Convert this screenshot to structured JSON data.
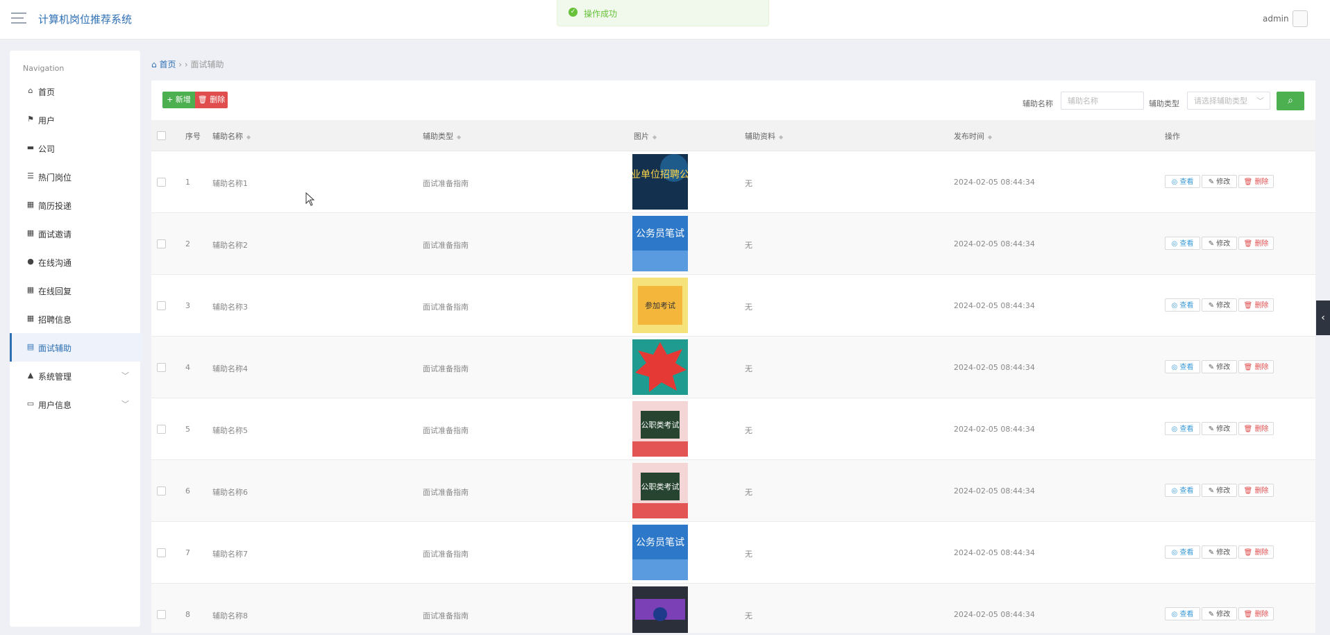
{
  "header": {
    "app_title": "计算机岗位推荐系统",
    "user": "admin",
    "toast": "操作成功"
  },
  "sidebar": {
    "nav_title": "Navigation",
    "items": [
      {
        "label": "首页",
        "icon": "home-icon"
      },
      {
        "label": "用户",
        "icon": "flag-icon"
      },
      {
        "label": "公司",
        "icon": "briefcase-icon"
      },
      {
        "label": "热门岗位",
        "icon": "list-icon"
      },
      {
        "label": "简历投递",
        "icon": "grid-icon"
      },
      {
        "label": "面试邀请",
        "icon": "grid-icon"
      },
      {
        "label": "在线沟通",
        "icon": "map-pin-icon"
      },
      {
        "label": "在线回复",
        "icon": "grid-icon"
      },
      {
        "label": "招聘信息",
        "icon": "grid-icon"
      },
      {
        "label": "面试辅助",
        "icon": "chat-icon",
        "active": true
      },
      {
        "label": "系统管理",
        "icon": "chart-icon",
        "expandable": true
      },
      {
        "label": "用户信息",
        "icon": "card-icon",
        "expandable": true
      }
    ]
  },
  "breadcrumb": {
    "home": "首页",
    "separator": "› ›",
    "current": "面试辅助"
  },
  "toolbar": {
    "add_label": "新增",
    "delete_label": "删除",
    "name_label": "辅助名称",
    "name_placeholder": "辅助名称",
    "type_label": "辅助类型",
    "type_placeholder": "请选择辅助类型"
  },
  "table": {
    "columns": [
      "序号",
      "辅助名称",
      "辅助类型",
      "图片",
      "辅助资料",
      "发布时间",
      "操作"
    ],
    "actions": {
      "view": "查看",
      "edit": "修改",
      "delete": "删除"
    },
    "rows": [
      {
        "no": "1",
        "name": "辅助名称1",
        "type": "面试准备指南",
        "thumb_text": "事业单位招聘公告",
        "material": "无",
        "time": "2024-02-05 08:44:34"
      },
      {
        "no": "2",
        "name": "辅助名称2",
        "type": "面试准备指南",
        "thumb_text": "公务员笔试",
        "material": "无",
        "time": "2024-02-05 08:44:34"
      },
      {
        "no": "3",
        "name": "辅助名称3",
        "type": "面试准备指南",
        "thumb_text": "参加考试",
        "material": "无",
        "time": "2024-02-05 08:44:34"
      },
      {
        "no": "4",
        "name": "辅助名称4",
        "type": "面试准备指南",
        "thumb_text": "",
        "material": "无",
        "time": "2024-02-05 08:44:34"
      },
      {
        "no": "5",
        "name": "辅助名称5",
        "type": "面试准备指南",
        "thumb_text": "公职类考试",
        "material": "无",
        "time": "2024-02-05 08:44:34"
      },
      {
        "no": "6",
        "name": "辅助名称6",
        "type": "面试准备指南",
        "thumb_text": "公职类考试",
        "material": "无",
        "time": "2024-02-05 08:44:34"
      },
      {
        "no": "7",
        "name": "辅助名称7",
        "type": "面试准备指南",
        "thumb_text": "公务员笔试",
        "material": "无",
        "time": "2024-02-05 08:44:34"
      },
      {
        "no": "8",
        "name": "辅助名称8",
        "type": "面试准备指南",
        "thumb_text": "",
        "material": "无",
        "time": "2024-02-05 08:44:34"
      }
    ]
  }
}
